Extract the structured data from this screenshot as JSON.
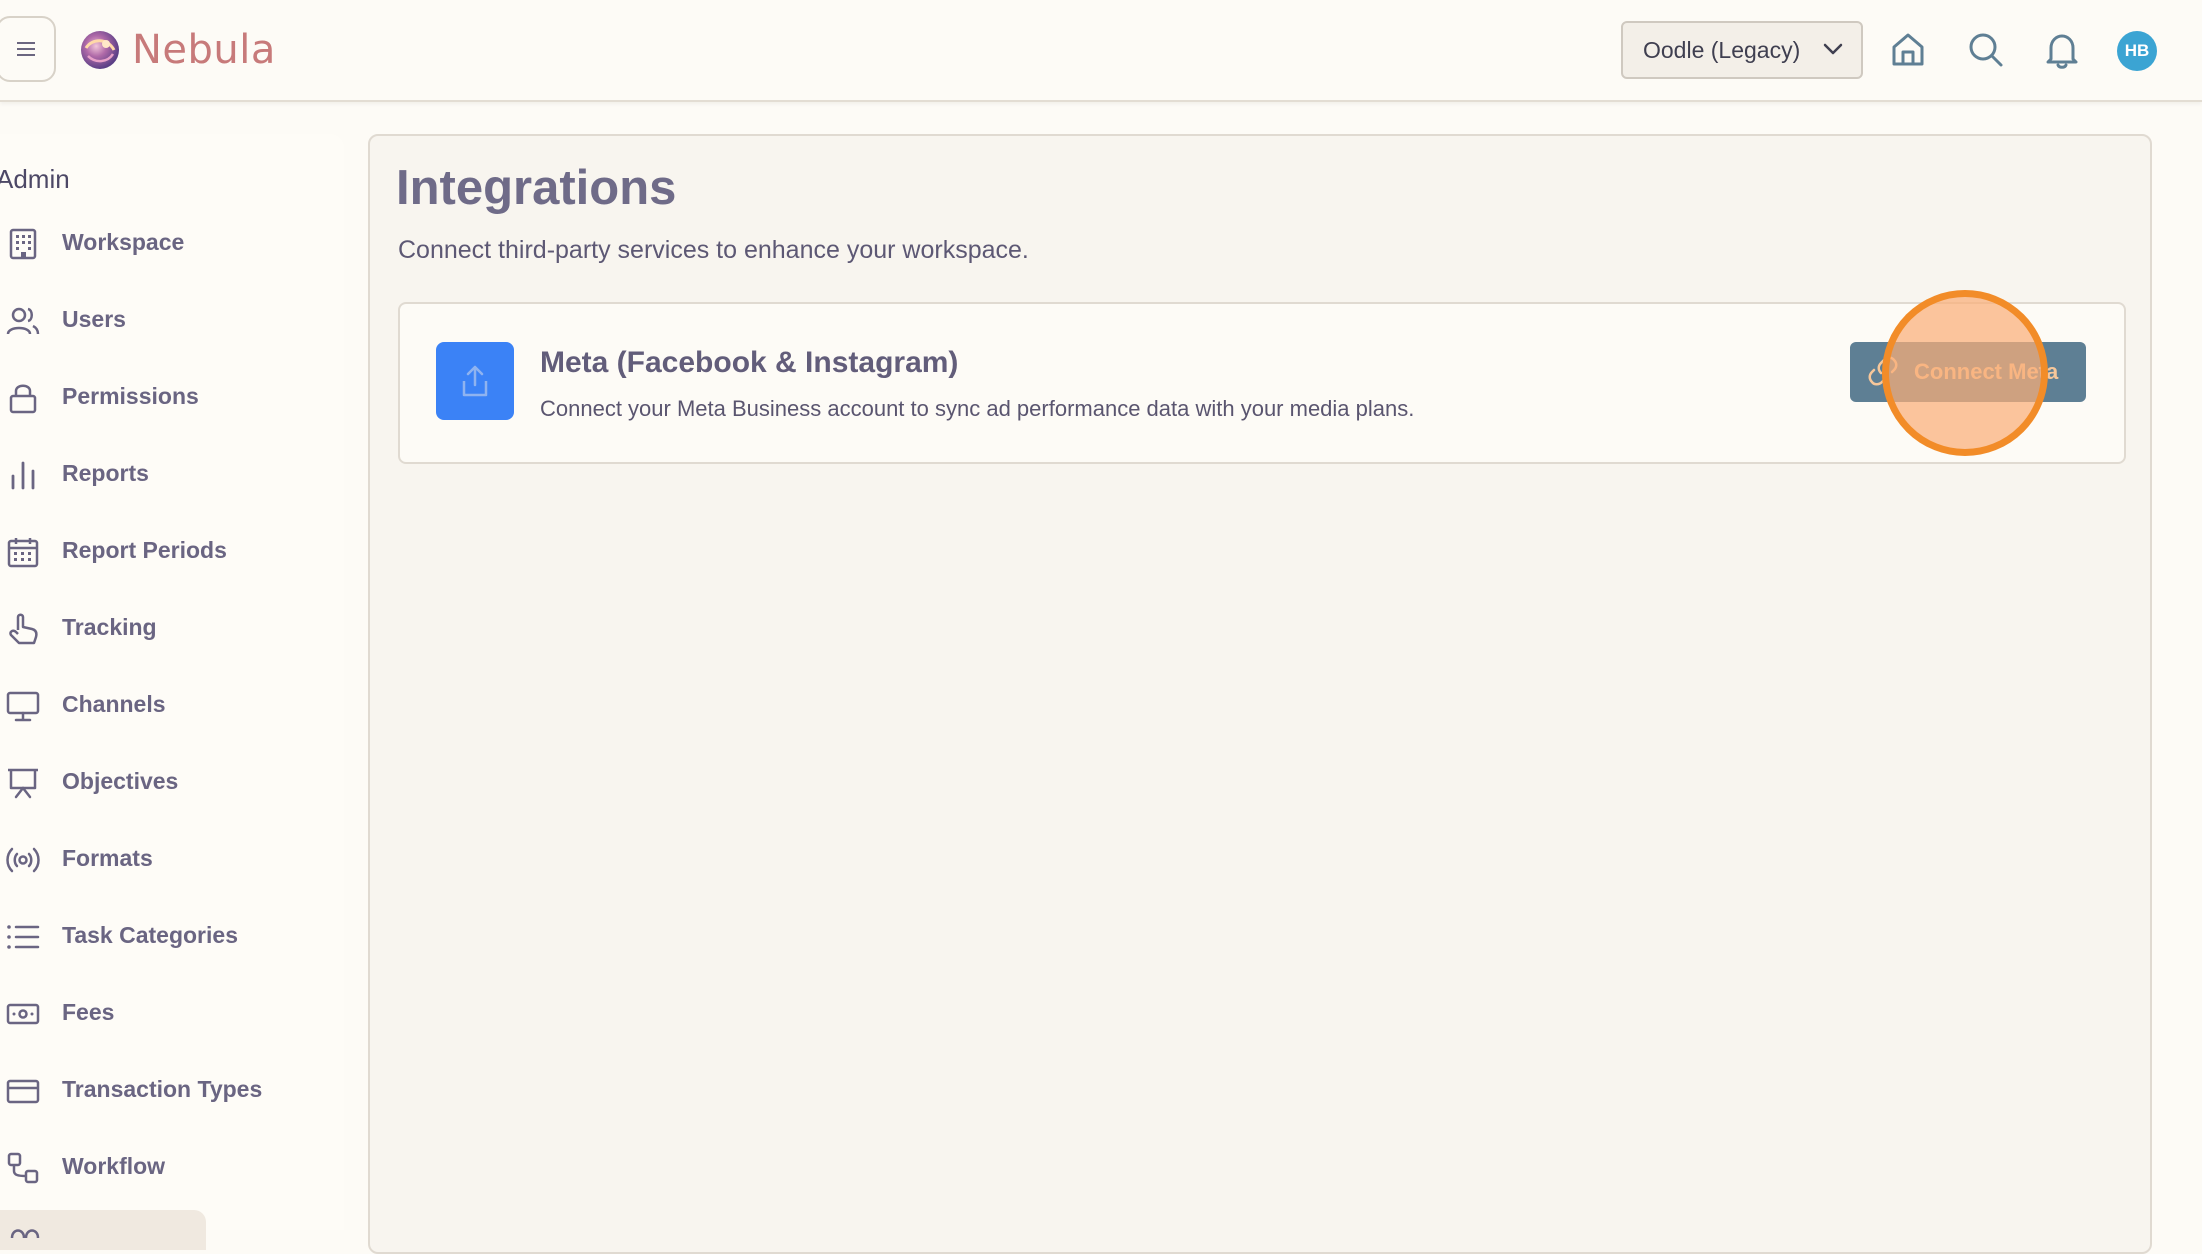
{
  "app": {
    "brand": "Nebula"
  },
  "header": {
    "workspace_select": {
      "value": "Oodle (Legacy)"
    },
    "avatar_initials": "HB",
    "icons": [
      "menu-icon",
      "home-icon",
      "search-icon",
      "bell-icon"
    ]
  },
  "sidebar": {
    "title": "Admin",
    "items": [
      {
        "label": "Workspace",
        "icon": "building-icon"
      },
      {
        "label": "Users",
        "icon": "users-icon"
      },
      {
        "label": "Permissions",
        "icon": "lock-icon"
      },
      {
        "label": "Reports",
        "icon": "bar-chart-icon"
      },
      {
        "label": "Report Periods",
        "icon": "calendar-icon"
      },
      {
        "label": "Tracking",
        "icon": "pointer-hand-icon"
      },
      {
        "label": "Channels",
        "icon": "monitor-icon"
      },
      {
        "label": "Objectives",
        "icon": "presentation-icon"
      },
      {
        "label": "Formats",
        "icon": "broadcast-icon"
      },
      {
        "label": "Task Categories",
        "icon": "list-icon"
      },
      {
        "label": "Fees",
        "icon": "banknote-icon"
      },
      {
        "label": "Transaction Types",
        "icon": "credit-card-icon"
      },
      {
        "label": "Workflow",
        "icon": "workflow-icon"
      }
    ]
  },
  "main": {
    "title": "Integrations",
    "subtitle": "Connect third-party services to enhance your workspace.",
    "integrations": [
      {
        "name": "Meta (Facebook & Instagram)",
        "description": "Connect your Meta Business account to sync ad performance data with your media plans.",
        "icon": "share-upload-icon",
        "action_label": "Connect Meta",
        "action_icon": "link-icon"
      }
    ]
  },
  "colors": {
    "background": "#fdfbf6",
    "brand": "#c77a7a",
    "card_icon_bg": "#3b82f6",
    "connect_button": "#5e7f94",
    "avatar": "#3ba4d3",
    "click_indicator": "#f28c28"
  }
}
